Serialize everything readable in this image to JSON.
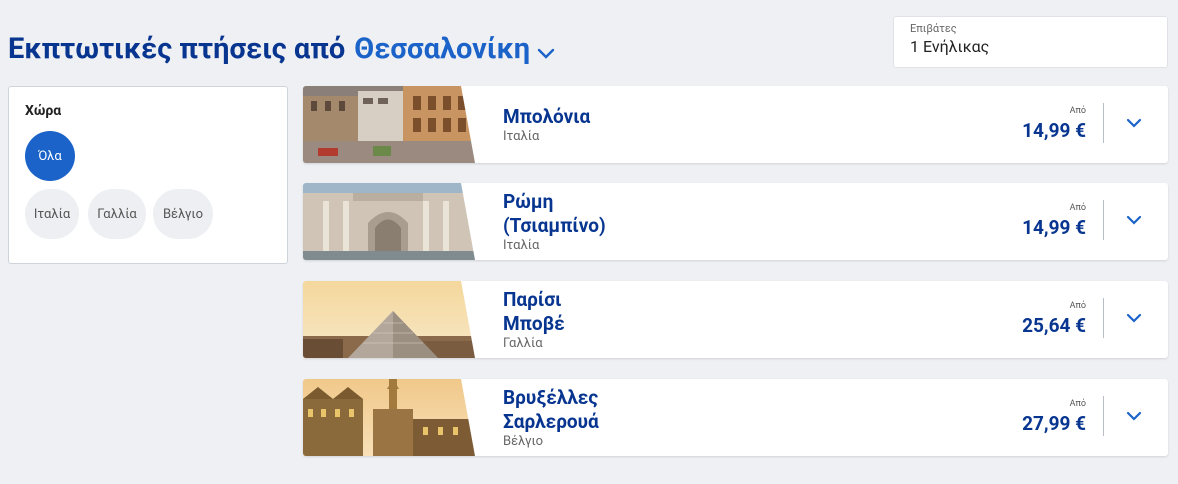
{
  "header": {
    "title_prefix": "Εκπτωτικές πτήσεις από",
    "origin_city": "Θεσσαλονίκη",
    "origin_dropdown_icon": "chevron-down-icon"
  },
  "passengers": {
    "label": "Επιβάτες",
    "value": "1 Ενήλικας"
  },
  "filter": {
    "heading": "Χώρα",
    "options": [
      {
        "label": "Όλα",
        "selected": true
      },
      {
        "label": "Ιταλία",
        "selected": false
      },
      {
        "label": "Γαλλία",
        "selected": false
      },
      {
        "label": "Βέλγιο",
        "selected": false
      }
    ]
  },
  "colors": {
    "brand_navy": "#073590",
    "accent_blue": "#1b63c9",
    "background": "#eef0f3"
  },
  "destinations": [
    {
      "name": "Μπολόνια",
      "country": "Ιταλία",
      "from_label": "Από",
      "price": "14,99 €",
      "expand_icon": "chevron-down-icon"
    },
    {
      "name": "Ρώμη\n(Τσιαμπίνο)",
      "country": "Ιταλία",
      "from_label": "Από",
      "price": "14,99 €",
      "expand_icon": "chevron-down-icon"
    },
    {
      "name": "Παρίσι\nΜποβέ",
      "country": "Γαλλία",
      "from_label": "Από",
      "price": "25,64 €",
      "expand_icon": "chevron-down-icon"
    },
    {
      "name": "Βρυξέλλες\nΣαρλερουά",
      "country": "Βέλγιο",
      "from_label": "Από",
      "price": "27,99 €",
      "expand_icon": "chevron-down-icon"
    }
  ]
}
